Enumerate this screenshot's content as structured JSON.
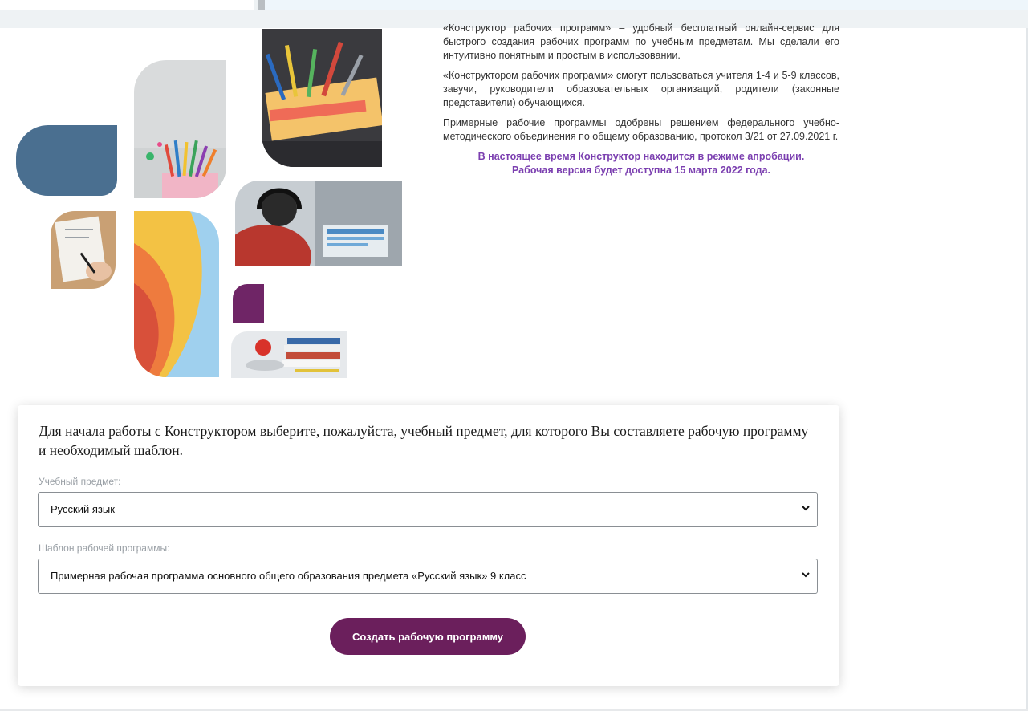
{
  "intro": {
    "paragraph1": "«Конструктор рабочих программ» – удобный бесплатный онлайн-сервис для быстрого создания рабочих программ по учебным предметам. Мы сделали его интуитивно понятным и простым в использовании.",
    "paragraph2": "«Конструктором рабочих программ» смогут пользоваться учителя 1-4 и 5-9 классов, завучи, руководители образовательных организаций, родители (законные представители) обучающихся.",
    "paragraph3": "Примерные рабочие программы одобрены решением федерального учебно-методического объединения по общему образованию, протокол 3/21 от 27.09.2021 г.",
    "notice_line1": "В настоящее время Конструктор находится в режиме апробации.",
    "notice_line2": "Рабочая версия будет доступна 15 марта 2022 года."
  },
  "form": {
    "title": "Для начала работы с Конструктором выберите, пожалуйста, учебный предмет, для которого Вы составляете рабочую программу и необходимый шаблон.",
    "subject_label": "Учебный предмет:",
    "subject_value": "Русский язык",
    "template_label": "Шаблон рабочей программы:",
    "template_value": "Примерная рабочая программа основного общего образования предмета «Русский язык» 9 класс",
    "submit_label": "Создать рабочую программу"
  },
  "colors": {
    "accent": "#6b1f5c",
    "notice": "#7b3fb0",
    "tile_blue": "#4a6f90",
    "tile_purple": "#6f2566"
  },
  "icons": {
    "select_arrow": "chevron-down-icon"
  }
}
